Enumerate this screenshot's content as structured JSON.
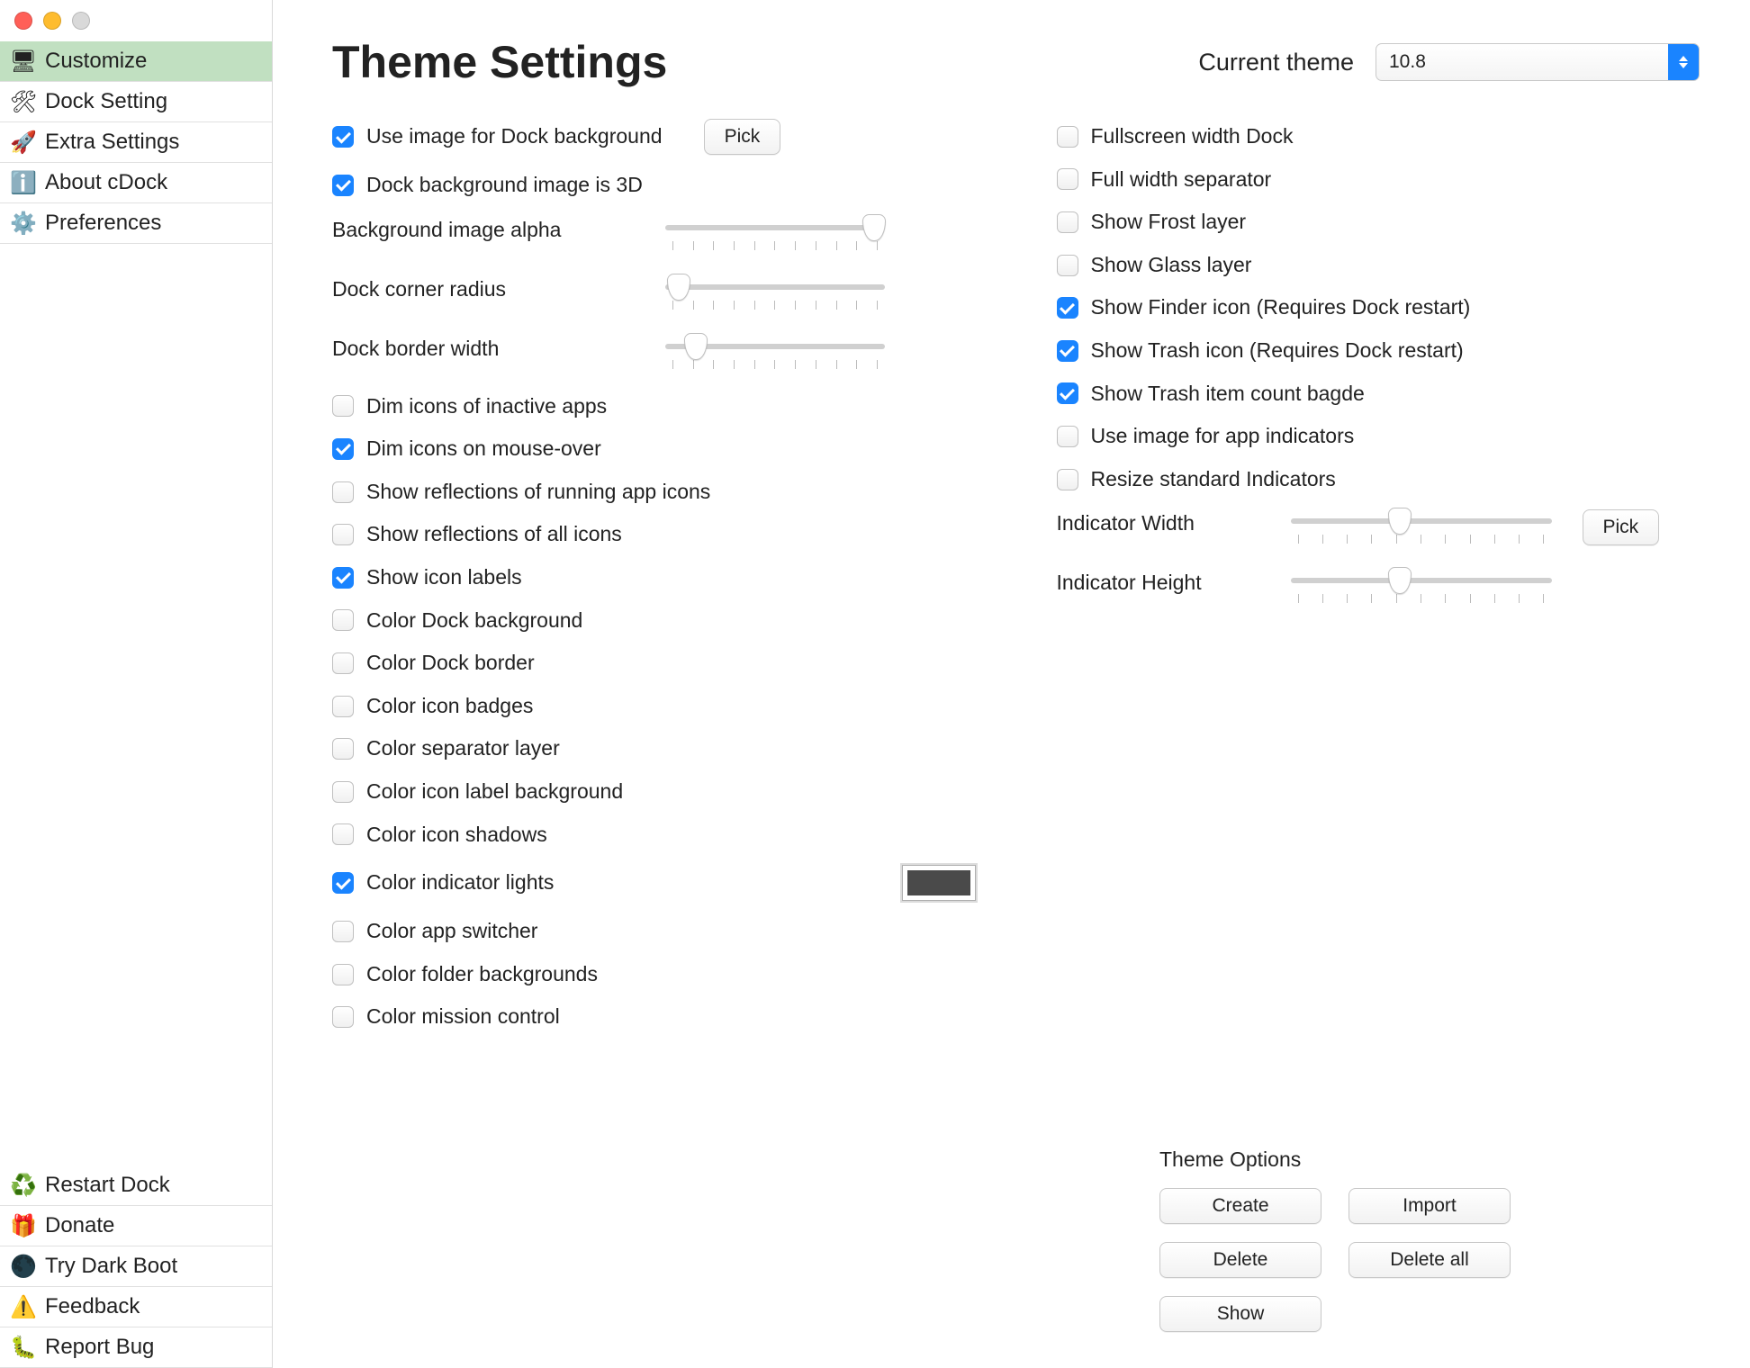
{
  "sidebar": {
    "main_items": [
      {
        "icon": "🖥",
        "label": "Customize",
        "selected": true
      },
      {
        "icon": "🛠",
        "label": "Dock Setting",
        "selected": false
      },
      {
        "icon": "🚀",
        "label": "Extra Settings",
        "selected": false
      },
      {
        "icon": "ℹ️",
        "label": "About cDock",
        "selected": false
      },
      {
        "icon": "⚙️",
        "label": "Preferences",
        "selected": false
      }
    ],
    "footer_items": [
      {
        "icon": "♻️",
        "label": "Restart Dock"
      },
      {
        "icon": "🎁",
        "label": "Donate"
      },
      {
        "icon": "🌑",
        "label": "Try Dark Boot"
      },
      {
        "icon": "⚠️",
        "label": "Feedback"
      },
      {
        "icon": "🐛",
        "label": "Report Bug"
      }
    ]
  },
  "header": {
    "title": "Theme Settings",
    "current_theme_label": "Current theme",
    "current_theme_value": "10.8"
  },
  "left_column": {
    "use_image_bg": {
      "label": "Use image for Dock background",
      "checked": true
    },
    "pick_button": "Pick",
    "bg_image_3d": {
      "label": "Dock background image is 3D",
      "checked": true
    },
    "sliders": {
      "bg_alpha": {
        "label": "Background image alpha",
        "value_pct": 95
      },
      "corner_radius": {
        "label": "Dock corner radius",
        "value_pct": 6
      },
      "border_width": {
        "label": "Dock border width",
        "value_pct": 14
      }
    },
    "checks": [
      {
        "key": "dim_inactive",
        "label": "Dim icons of inactive apps",
        "checked": false
      },
      {
        "key": "dim_mouseover",
        "label": "Dim icons on mouse-over",
        "checked": true
      },
      {
        "key": "refl_running",
        "label": "Show reflections of running app icons",
        "checked": false
      },
      {
        "key": "refl_all",
        "label": "Show reflections of all icons",
        "checked": false
      },
      {
        "key": "show_labels",
        "label": "Show icon labels",
        "checked": true
      },
      {
        "key": "color_dock_bg",
        "label": "Color Dock background",
        "checked": false
      },
      {
        "key": "color_dock_border",
        "label": "Color Dock border",
        "checked": false
      },
      {
        "key": "color_badges",
        "label": "Color icon badges",
        "checked": false
      },
      {
        "key": "color_sep",
        "label": "Color separator layer",
        "checked": false
      },
      {
        "key": "color_label_bg",
        "label": "Color icon label background",
        "checked": false
      },
      {
        "key": "color_shadows",
        "label": "Color icon shadows",
        "checked": false
      },
      {
        "key": "color_indicator",
        "label": "Color indicator lights",
        "checked": true,
        "has_color_well": true,
        "color": "#4a4a4a"
      },
      {
        "key": "color_app_switcher",
        "label": "Color app switcher",
        "checked": false
      },
      {
        "key": "color_folder_bg",
        "label": "Color folder backgrounds",
        "checked": false
      },
      {
        "key": "color_mission",
        "label": "Color mission control",
        "checked": false
      }
    ]
  },
  "right_column": {
    "checks": [
      {
        "key": "fullscreen_dock",
        "label": "Fullscreen width Dock",
        "checked": false
      },
      {
        "key": "full_sep",
        "label": "Full width separator",
        "checked": false
      },
      {
        "key": "frost",
        "label": "Show Frost layer",
        "checked": false
      },
      {
        "key": "glass",
        "label": "Show Glass layer",
        "checked": false
      },
      {
        "key": "finder_icon",
        "label": "Show Finder icon (Requires Dock restart)",
        "checked": true
      },
      {
        "key": "trash_icon",
        "label": "Show Trash icon (Requires Dock restart)",
        "checked": true
      },
      {
        "key": "trash_badge",
        "label": "Show Trash item count bagde",
        "checked": true
      },
      {
        "key": "img_indicators",
        "label": "Use image for app indicators",
        "checked": false
      },
      {
        "key": "resize_indic",
        "label": "Resize standard Indicators",
        "checked": false
      }
    ],
    "indicator_width": {
      "label": "Indicator Width",
      "value_pct": 42,
      "pick_button": "Pick"
    },
    "indicator_height": {
      "label": "Indicator Height",
      "value_pct": 42
    }
  },
  "theme_options": {
    "title": "Theme Options",
    "buttons": {
      "create": "Create",
      "import": "Import",
      "delete": "Delete",
      "delete_all": "Delete all",
      "show": "Show"
    }
  }
}
